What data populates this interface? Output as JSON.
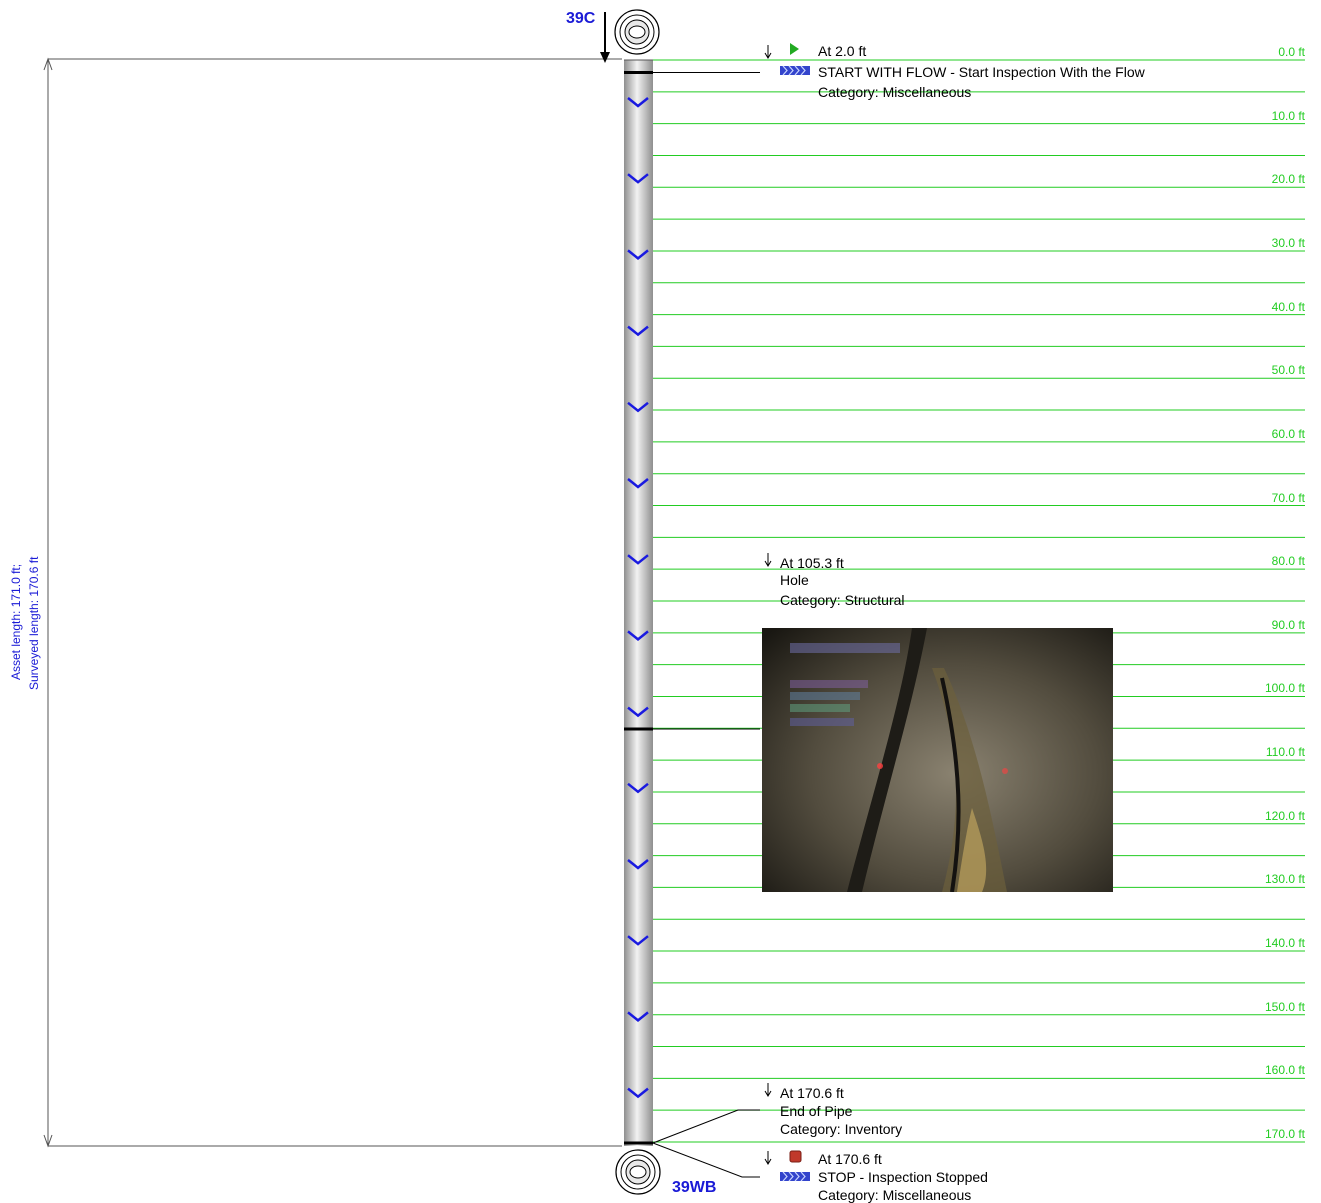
{
  "upstream_manhole": {
    "label": "39C"
  },
  "downstream_manhole": {
    "label": "39WB"
  },
  "asset_summary": {
    "asset_length_text": "Asset length: 171.0 ft;",
    "surveyed_length_text": "Surveyed length: 170.6 ft"
  },
  "pipe_total_ft": 170.6,
  "scale": {
    "labels": [
      "0.0 ft",
      "10.0 ft",
      "20.0 ft",
      "30.0 ft",
      "40.0 ft",
      "50.0 ft",
      "60.0 ft",
      "70.0 ft",
      "80.0 ft",
      "90.0 ft",
      "100.0 ft",
      "110.0 ft",
      "120.0 ft",
      "130.0 ft",
      "140.0 ft",
      "150.0 ft",
      "160.0 ft",
      "170.0 ft"
    ]
  },
  "observations": [
    {
      "at": "At 2.0 ft",
      "title": "START WITH FLOW - Start Inspection With the Flow",
      "category": "Category: Miscellaneous",
      "icon": "green-flag-icon"
    },
    {
      "at": "At 105.3 ft",
      "title": "Hole",
      "category": "Category: Structural",
      "icon": "none"
    },
    {
      "at": "At 170.6 ft",
      "title": "End of Pipe",
      "category": "Category: Inventory",
      "icon": "none"
    },
    {
      "at": "At 170.6 ft",
      "title": "STOP - Inspection Stopped",
      "category": "Category: Miscellaneous",
      "icon": "red-stop-icon"
    }
  ],
  "colors": {
    "scale_green": "#22cc22",
    "label_blue": "#1a1ad6",
    "flow_chevron": "#1a1ae0"
  }
}
